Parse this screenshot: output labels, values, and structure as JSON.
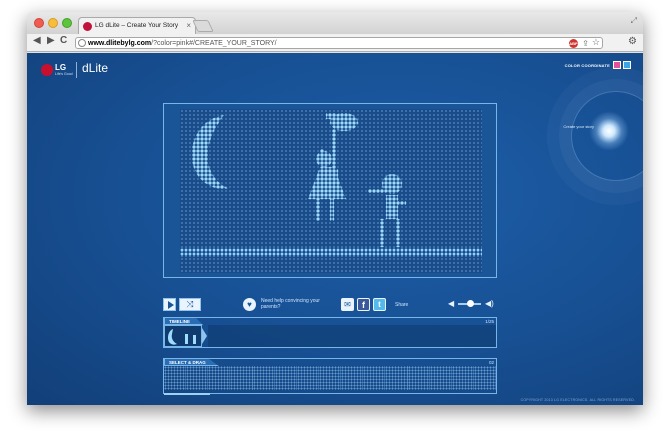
{
  "browser": {
    "tab_title": "LG dLite – Create Your Story",
    "tab_close": "×",
    "url_domain": "www.dlitebylg.com",
    "url_path": "/?color=pink#/CREATE_YOUR_STORY/",
    "nav_back": "◀",
    "nav_forward": "▶",
    "nav_reload": "C",
    "star": "☆",
    "wrench": "🔧",
    "adblock_label": "ABP"
  },
  "header": {
    "brand": "LG",
    "tagline": "Life's Good",
    "product_logo": "dLite",
    "color_coordinate_label": "COLOR COORDINATE",
    "colors": {
      "pink": "#e4509a",
      "blue": "#3ea6e5"
    }
  },
  "side": {
    "create_story_label": "Create your story"
  },
  "controls": {
    "shuffle_symbol": "⤨",
    "heart_symbol": "♥",
    "help_text": "Need help convincing your parents?",
    "email_symbol": "✉",
    "facebook_label": "f",
    "twitter_label": "t",
    "share_label": "Share",
    "volume_low_symbol": "◀",
    "volume_high_symbol": "◀)",
    "volume_level": 0.55
  },
  "timeline": {
    "label": "TIMELINE",
    "counter": "1/25"
  },
  "select_drag": {
    "label": "SELECT & DRAG",
    "counter": "02",
    "scene_count": 15
  },
  "footer": {
    "copyright": "COPYRIGHT 2013 LG ELECTRONICS. ALL RIGHTS RESERVED."
  }
}
